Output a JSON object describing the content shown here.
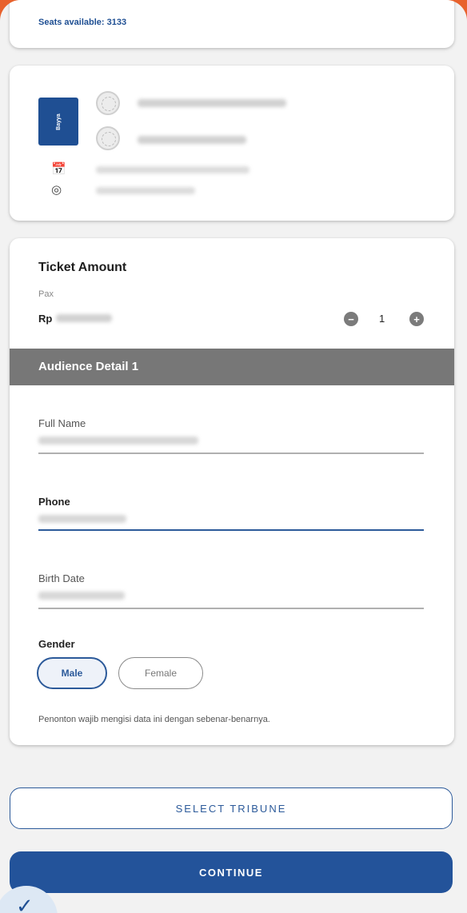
{
  "seats": {
    "text": "Seats available: 3133"
  },
  "event": {
    "logo_text": "Bayya",
    "calendar_icon": "calendar-icon",
    "location_icon": "location-pin-icon"
  },
  "ticket": {
    "title": "Ticket Amount",
    "pax_label": "Pax",
    "price_prefix": "Rp",
    "minus_label": "−",
    "plus_label": "+",
    "quantity": "1"
  },
  "audience": {
    "header": "Audience Detail 1",
    "full_name_label": "Full Name",
    "phone_label": "Phone",
    "birth_date_label": "Birth Date",
    "gender_label": "Gender",
    "gender_options": [
      "Male",
      "Female"
    ],
    "gender_selected": "Male",
    "disclaimer": "Penonton wajib mengisi data ini dengan sebenar-benarnya."
  },
  "actions": {
    "select_tribune": "SELECT TRIBUNE",
    "continue": "CONTINUE"
  },
  "colors": {
    "primary": "#23539a",
    "header_gray": "#777777",
    "frame_accent": "#e8622d"
  }
}
